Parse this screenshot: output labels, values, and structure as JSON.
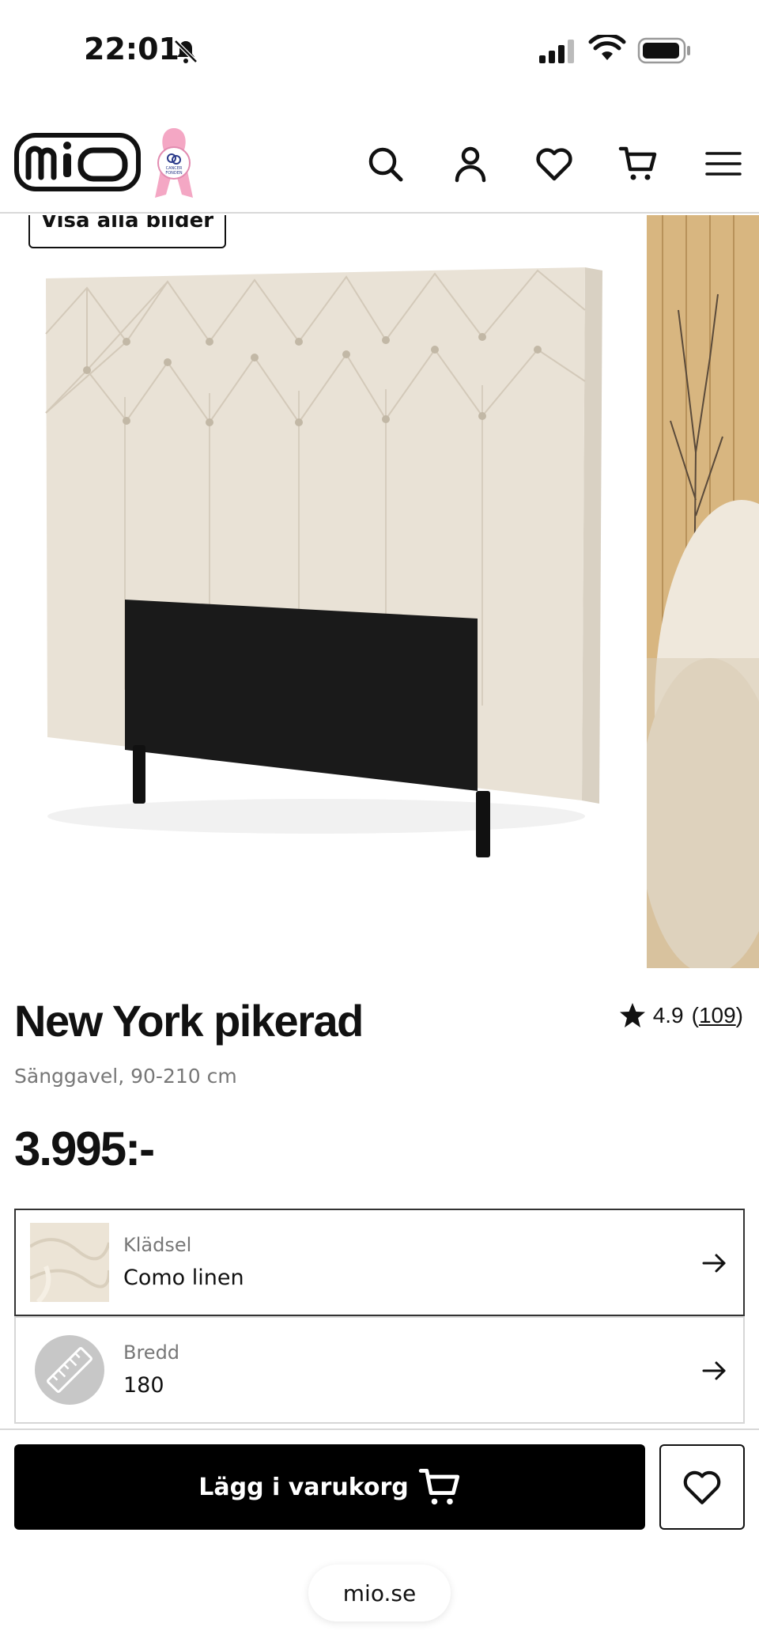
{
  "status_bar": {
    "time": "22:01"
  },
  "header": {
    "logo_text": "mio",
    "partner_logo_text": "CANCER FONDEN",
    "icons": [
      "search-icon",
      "account-icon",
      "heart-icon",
      "cart-icon",
      "menu-icon"
    ]
  },
  "gallery": {
    "view_all_label": "Visa alla bilder"
  },
  "product": {
    "title": "New York pikerad",
    "subtitle": "Sänggavel, 90-210 cm",
    "price": "3.995:-",
    "rating_value": "4.9",
    "rating_count_open": "(",
    "rating_count": "109",
    "rating_count_close": ")"
  },
  "options": [
    {
      "label": "Klädsel",
      "value": "Como linen"
    },
    {
      "label": "Bredd",
      "value": "180"
    }
  ],
  "actions": {
    "add_to_cart_label": "Lägg i varukorg"
  },
  "browser": {
    "url": "mio.se"
  },
  "colors": {
    "accent": "#000000",
    "ribbon": "#f4a7c4",
    "fabric": "#e9e2d6"
  }
}
